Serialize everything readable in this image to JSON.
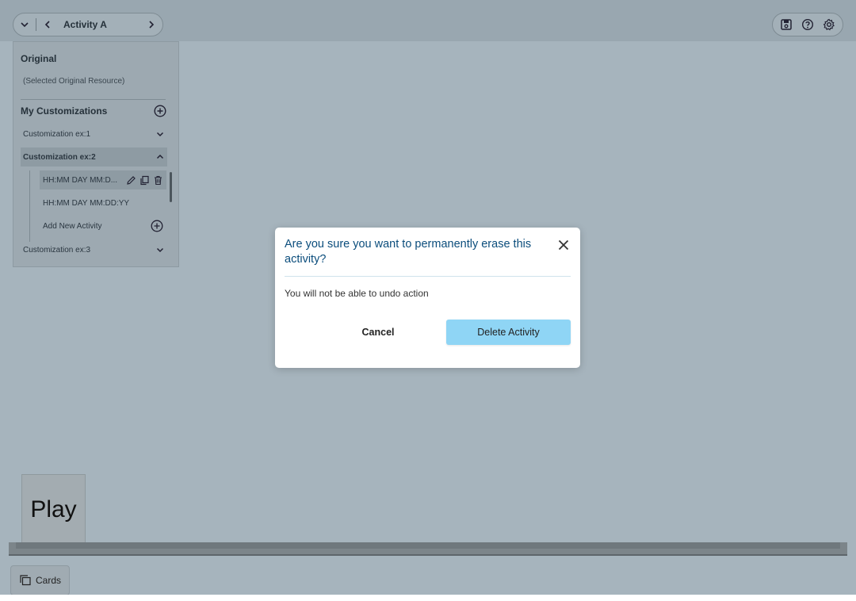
{
  "toolbar": {
    "activity_title": "Activity A",
    "icons": [
      "chevron-down-icon",
      "chevron-left-icon",
      "chevron-right-icon",
      "save-icon",
      "help-icon",
      "gear-icon"
    ]
  },
  "sidebar": {
    "original_title": "Original",
    "original_resource": "(Selected Original Resource)",
    "customizations_title": "My Customizations",
    "customizations": [
      {
        "label": "Customization ex:1",
        "expanded": false
      },
      {
        "label": "Customization ex:2",
        "expanded": true
      },
      {
        "label": "Customization ex:3",
        "expanded": false
      }
    ],
    "activities": [
      {
        "label": "HH:MM DAY MM:D...",
        "selected": true
      },
      {
        "label": "HH:MM DAY MM:DD:YY",
        "selected": false
      }
    ],
    "add_activity_label": "Add New Activity"
  },
  "play_card": {
    "label": "Play"
  },
  "cards_button": {
    "label": "Cards"
  },
  "dialog": {
    "title": "Are you sure you want to permanently erase this activity?",
    "message": "You will not be able to undo action",
    "cancel_label": "Cancel",
    "delete_label": "Delete Activity"
  },
  "colors": {
    "overlay": "#a6b4bd",
    "dialog_title": "#0b4d7c",
    "delete_button": "#8fd5f5"
  }
}
